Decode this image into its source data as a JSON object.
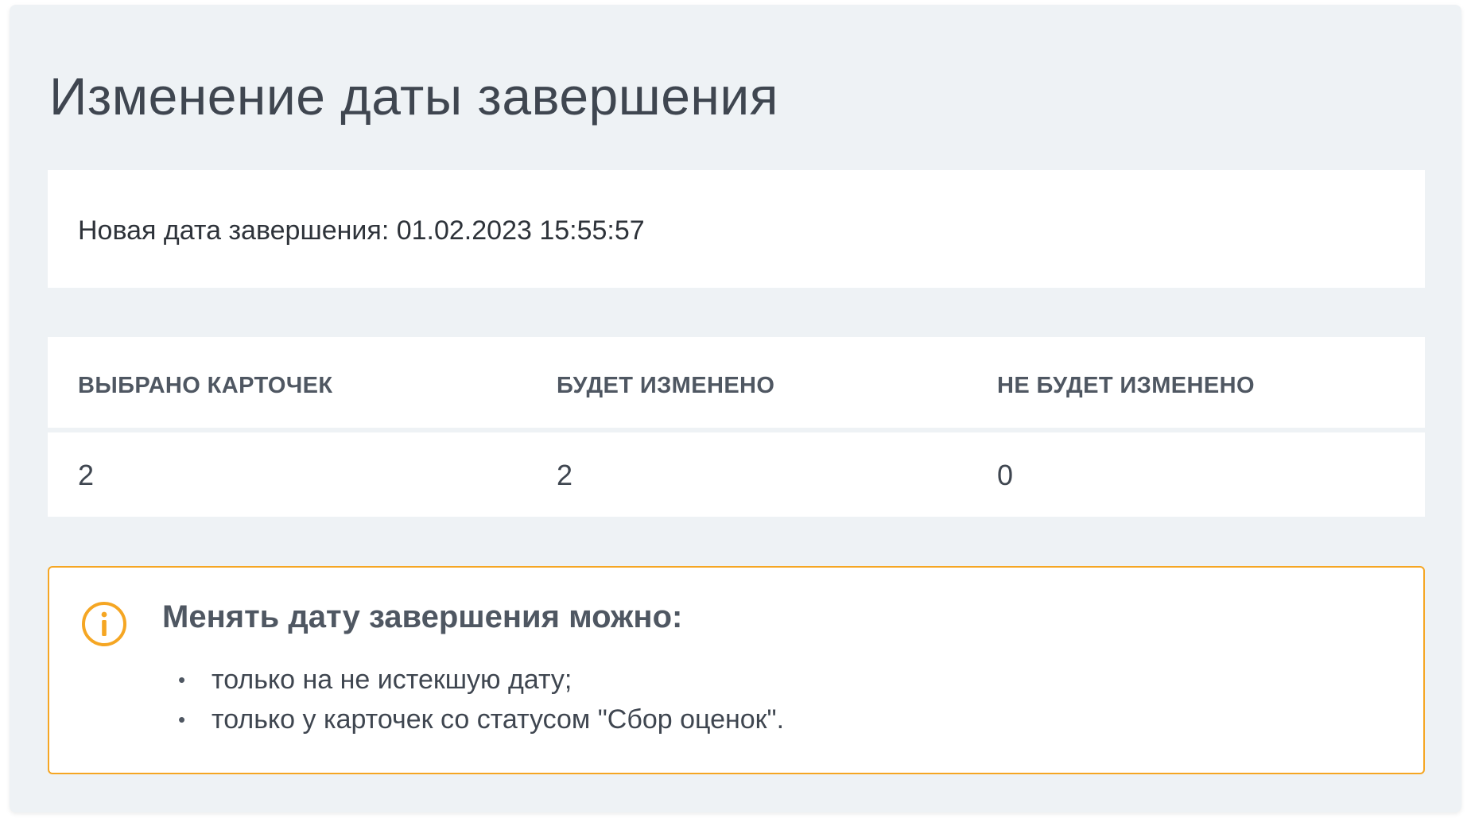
{
  "title": "Изменение даты завершения",
  "date": {
    "label": "Новая дата завершения:",
    "value": "01.02.2023 15:55:57"
  },
  "stats": {
    "headers": [
      "ВЫБРАНО КАРТОЧЕК",
      "БУДЕТ ИЗМЕНЕНО",
      "НЕ БУДЕТ ИЗМЕНЕНО"
    ],
    "values": [
      "2",
      "2",
      "0"
    ]
  },
  "notice": {
    "icon": "info-icon",
    "accent_color": "#f5a623",
    "title": "Менять дату завершения можно:",
    "items": [
      "только на не истекшую дату;",
      "только у карточек со статусом \"Сбор оценок\"."
    ]
  }
}
